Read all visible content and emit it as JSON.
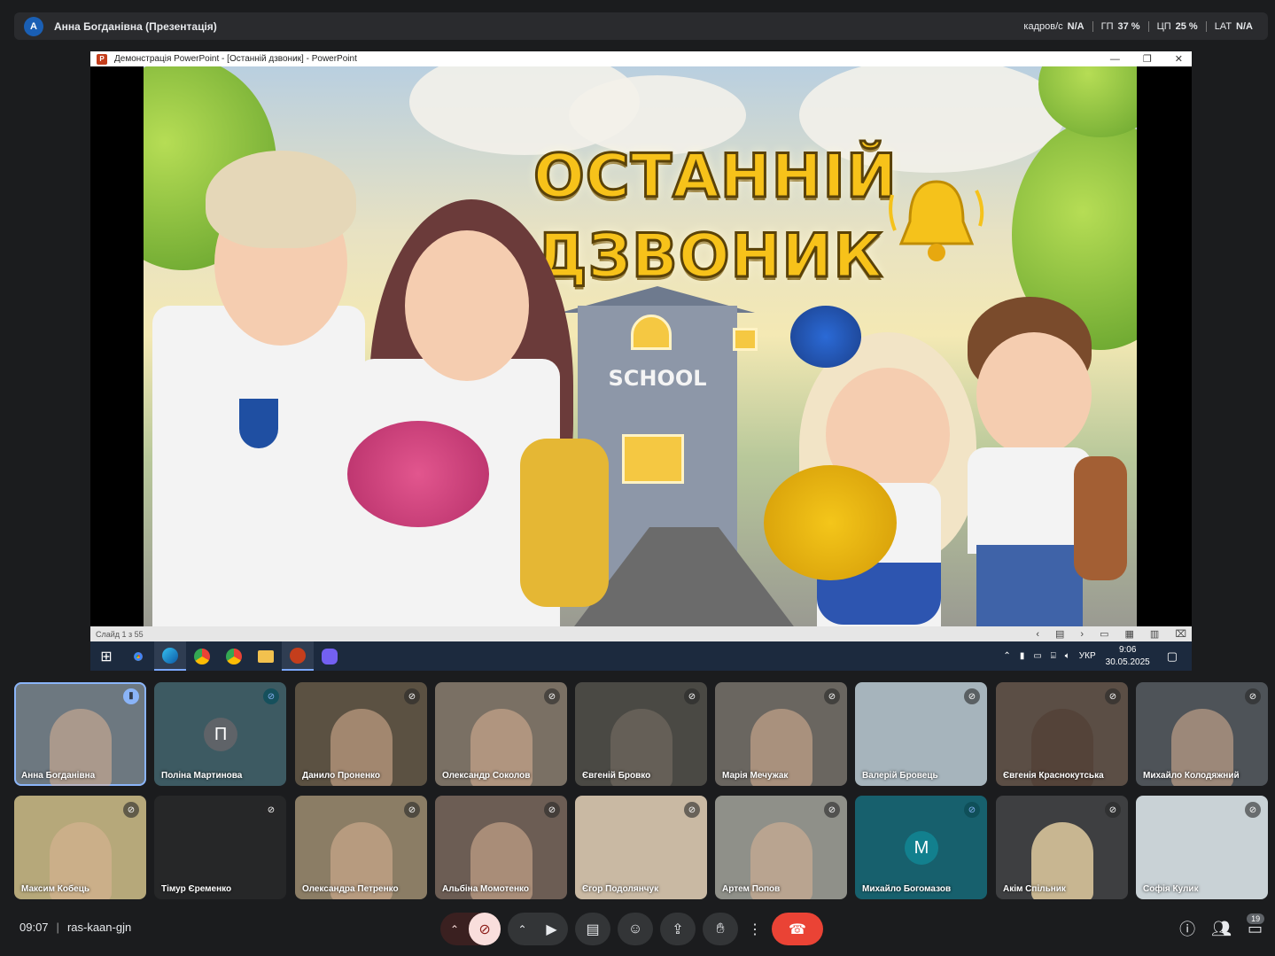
{
  "topbar": {
    "avatar_initial": "А",
    "presenter": "Анна Богданівна (Презентація)",
    "stats": [
      {
        "label": "кадров/с",
        "value": "N/A"
      },
      {
        "label": "ГП",
        "value": "37 %"
      },
      {
        "label": "ЦП",
        "value": "25 %"
      },
      {
        "label": "LAT",
        "value": "N/A"
      }
    ]
  },
  "ppt": {
    "window_title": "Демонстрація PowerPoint - [Останній дзвоник] - PowerPoint",
    "logo_letter": "P",
    "win_minimize": "—",
    "win_restore": "❐",
    "win_close": "✕",
    "slide_title_line1": "ОСТАННІЙ",
    "slide_title_line2": "ДЗВОНИК",
    "slide_sign": "SCHOOL",
    "status": "Слайд 1 з 55"
  },
  "taskbar": {
    "lang": "УКР",
    "time": "9:06",
    "date": "30.05.2025"
  },
  "participants": [
    {
      "name": "Анна Богданівна",
      "speaking": true,
      "kind": "video"
    },
    {
      "name": "Поліна Мартинова",
      "initial": "П",
      "kind": "avatar",
      "color": "#5f6368"
    },
    {
      "name": "Данило Проненко",
      "kind": "video"
    },
    {
      "name": "Олександр Соколов",
      "kind": "video"
    },
    {
      "name": "Євгеній Бровко",
      "kind": "video"
    },
    {
      "name": "Марія Мечужак",
      "kind": "video"
    },
    {
      "name": "Валерій Бровець",
      "kind": "video"
    },
    {
      "name": "Євгенія Краснокутська",
      "kind": "video"
    },
    {
      "name": "Михайло Колодяжний",
      "kind": "video"
    },
    {
      "name": "Максим Кобець",
      "kind": "video"
    },
    {
      "name": "Тімур Єременко",
      "kind": "video"
    },
    {
      "name": "Олександра Петренко",
      "kind": "video"
    },
    {
      "name": "Альбіна Момотенко",
      "kind": "video"
    },
    {
      "name": "Єгор Подолянчук",
      "kind": "video"
    },
    {
      "name": "Артем Попов",
      "kind": "video"
    },
    {
      "name": "Михайло Богомазов",
      "initial": "М",
      "kind": "avatar",
      "color": "#12808e"
    },
    {
      "name": "Акім Спільник",
      "kind": "video"
    },
    {
      "name": "Софія Кулик",
      "kind": "video"
    }
  ],
  "meeting": {
    "time": "09:07",
    "code": "ras-kaan-gjn",
    "participant_count": "19"
  }
}
